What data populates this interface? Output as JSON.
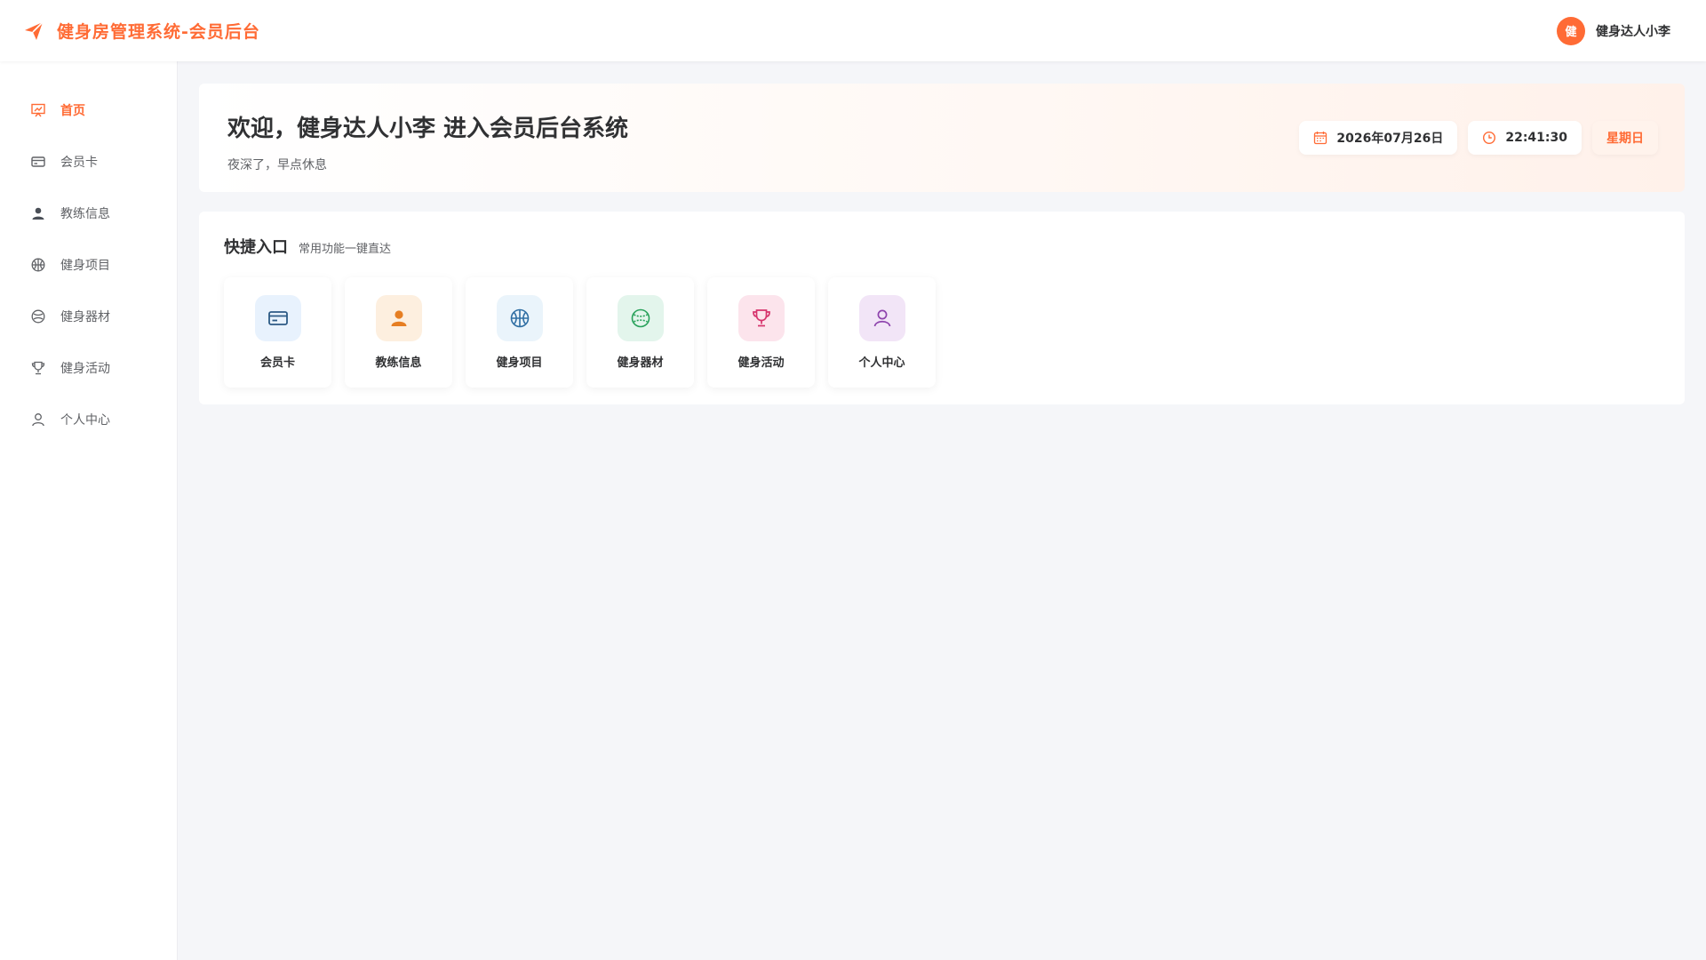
{
  "header": {
    "title": "健身房管理系统-会员后台",
    "avatar_text": "健",
    "username": "健身达人小李",
    "brand_icon": "paper-plane-icon",
    "accent": "#ff6b35"
  },
  "sidebar": {
    "items": [
      {
        "label": "首页",
        "icon": "home-presentation-icon",
        "active": true
      },
      {
        "label": "会员卡",
        "icon": "card-icon"
      },
      {
        "label": "教练信息",
        "icon": "user-icon"
      },
      {
        "label": "健身项目",
        "icon": "basketball-icon"
      },
      {
        "label": "健身器材",
        "icon": "ball-icon"
      },
      {
        "label": "健身活动",
        "icon": "trophy-icon"
      },
      {
        "label": "个人中心",
        "icon": "person-outline-icon"
      }
    ]
  },
  "welcome": {
    "title": "欢迎，健身达人小李 进入会员后台系统",
    "subtitle": "夜深了，早点休息",
    "date": "2026年07月26日",
    "time": "22:41:30",
    "weekday": "星期日"
  },
  "quick": {
    "title": "快捷入口",
    "subtitle": "常用功能一键直达",
    "tiles": [
      {
        "label": "会员卡",
        "icon": "card-icon",
        "bg": "#e8f2fd",
        "color": "#2c5a85"
      },
      {
        "label": "教练信息",
        "icon": "user-icon",
        "bg": "#fdefdf",
        "color": "#e67e22"
      },
      {
        "label": "健身项目",
        "icon": "basketball-icon",
        "bg": "#eaf4fb",
        "color": "#2f6ea3"
      },
      {
        "label": "健身器材",
        "icon": "ball-icon",
        "bg": "#e3f5ec",
        "color": "#27a15a"
      },
      {
        "label": "健身活动",
        "icon": "trophy-icon",
        "bg": "#fce4ec",
        "color": "#d6336c"
      },
      {
        "label": "个人中心",
        "icon": "person-outline-icon",
        "bg": "#f2e5f7",
        "color": "#8e44ad"
      }
    ]
  }
}
